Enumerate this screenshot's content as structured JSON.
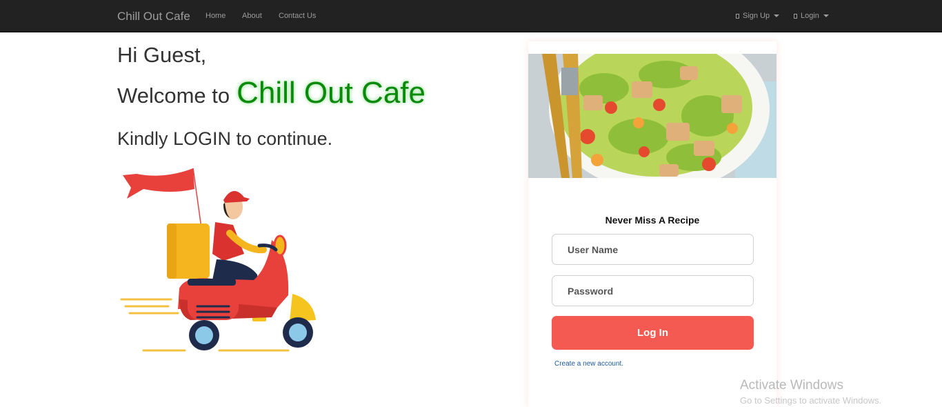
{
  "navbar": {
    "brand": "Chill Out Cafe",
    "links": [
      "Home",
      "About",
      "Contact Us"
    ],
    "signup": "Sign Up",
    "login": "Login"
  },
  "hero": {
    "greeting": "Hi Guest,",
    "welcome_prefix": "Welcome to",
    "cafe_name": "Chill Out Cafe",
    "prompt": "Kindly LOGIN to continue."
  },
  "login_card": {
    "title": "Never Miss A Recipe",
    "username_placeholder": "User Name",
    "password_placeholder": "Password",
    "button": "Log In",
    "create_link": "Create a new account."
  },
  "watermark": {
    "title": "Activate Windows",
    "subtitle": "Go to Settings to activate Windows."
  },
  "colors": {
    "navbar": "#222222",
    "accent_green": "#0a8a0a",
    "button": "#f55a52",
    "link": "#1d5aa0"
  }
}
